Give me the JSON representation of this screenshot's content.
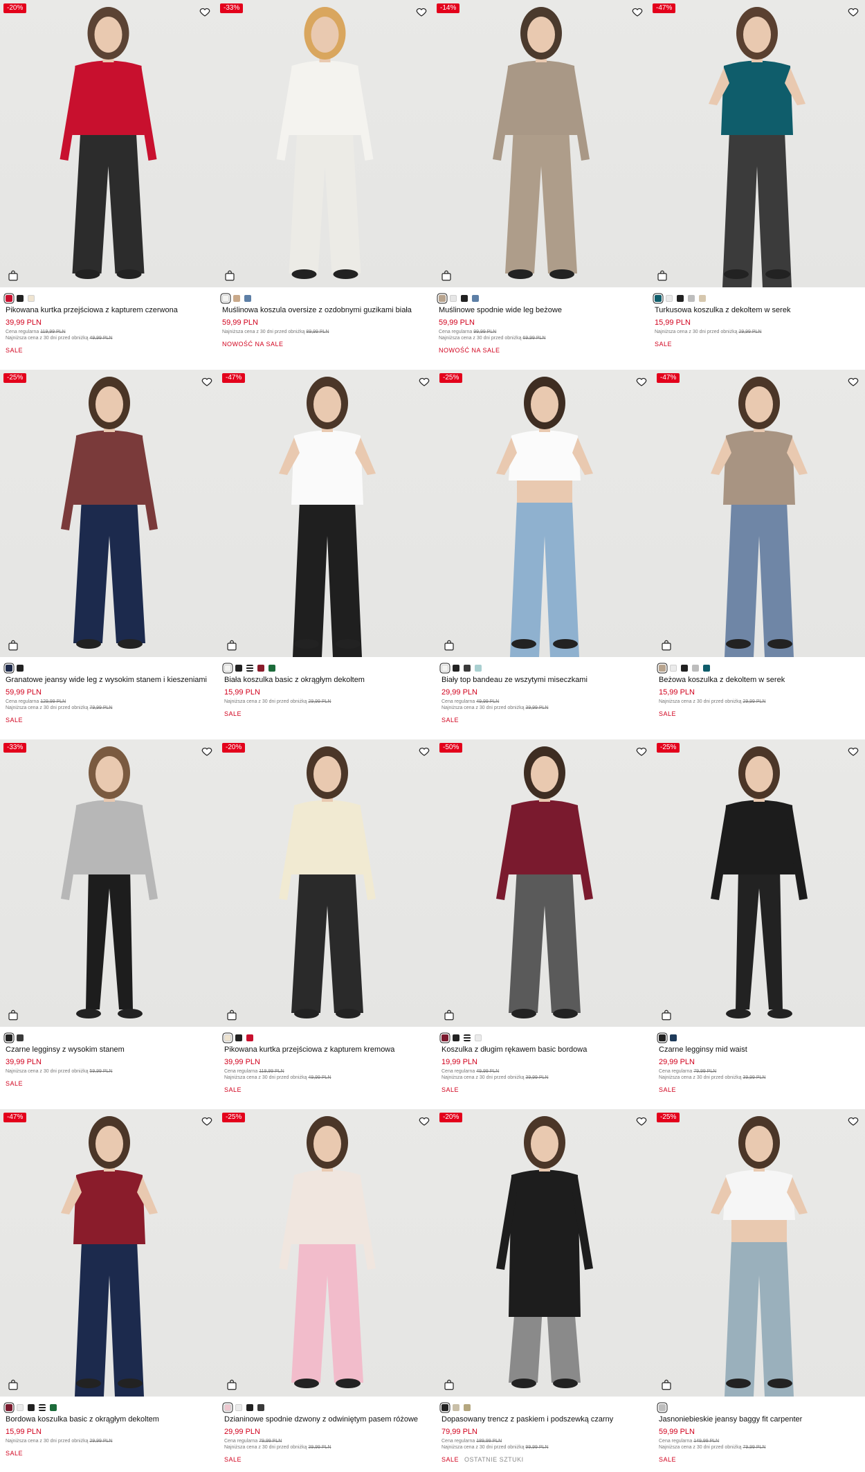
{
  "labels": {
    "regular": "Cena regularna",
    "lowest": "Najniższa cena z 30 dni przed obniżką"
  },
  "colors": {
    "accent": "#d1001c",
    "badge": "#e3001b",
    "photo_bg": "#e5e5e3"
  },
  "products": [
    {
      "badge": "-20%",
      "name": "Pikowana kurtka przejściowa z kapturem czerwona",
      "price": "39,99 PLN",
      "regular": "119,99 PLN",
      "lowest": "49,99 PLN",
      "tag": "SALE",
      "extra": "",
      "swatches": [
        "#c8102e",
        "#222222",
        "#efe4d0"
      ],
      "garment": {
        "top": "#c8102e",
        "bottom": "#2c2c2c",
        "hair": "#5b4334",
        "kind": "jacket-pants"
      }
    },
    {
      "badge": "-33%",
      "name": "Muślinowa koszula oversize z ozdobnymi guzikami biała",
      "price": "59,99 PLN",
      "regular": "",
      "lowest": "89,99 PLN",
      "tag": "NOWOŚĆ NA SALE",
      "extra": "",
      "swatches": [
        "#f4f4f2",
        "#c9a98a",
        "#5d7fa6"
      ],
      "garment": {
        "top": "#f4f3ef",
        "bottom": "#ecebe6",
        "hair": "#d9a65e",
        "kind": "shirt-pants"
      }
    },
    {
      "badge": "-14%",
      "name": "Muślinowe spodnie wide leg beżowe",
      "price": "59,99 PLN",
      "regular": "99,99 PLN",
      "lowest": "69,99 PLN",
      "tag": "NOWOŚĆ NA SALE",
      "extra": "",
      "swatches": [
        "#b8a48e",
        "#e6e6e6",
        "#222222",
        "#5d7fa6"
      ],
      "garment": {
        "top": "#a99886",
        "bottom": "#ae9d8a",
        "hair": "#4b3a2d",
        "kind": "shirt-pants"
      }
    },
    {
      "badge": "-47%",
      "name": "Turkusowa koszulka z dekoltem w serek",
      "price": "15,99 PLN",
      "regular": "",
      "lowest": "29,99 PLN",
      "tag": "SALE",
      "extra": "",
      "swatches": [
        "#0f5d6b",
        "#ebebeb",
        "#222222",
        "#bdbdbd",
        "#d6c7ae"
      ],
      "garment": {
        "top": "#0f5d6b",
        "bottom": "#3b3b3b",
        "hair": "#5a4030",
        "kind": "tee-jeans"
      }
    },
    {
      "badge": "-25%",
      "name": "Granatowe jeansy wide leg z wysokim stanem i kieszeniami",
      "price": "59,99 PLN",
      "regular": "129,99 PLN",
      "lowest": "79,99 PLN",
      "tag": "SALE",
      "extra": "",
      "swatches": [
        "#1e2a4a",
        "#222222"
      ],
      "garment": {
        "top": "#7a3a3a",
        "bottom": "#1c2a4d",
        "hair": "#4a3526",
        "kind": "shirt-pants"
      }
    },
    {
      "badge": "-47%",
      "name": "Biała koszulka basic z okrągłym dekoltem",
      "price": "15,99 PLN",
      "regular": "",
      "lowest": "29,99 PLN",
      "tag": "SALE",
      "extra": "",
      "swatches": [
        "#f4f4f2",
        "#222222",
        "stripes",
        "#8a1c2b",
        "#1c6b3a"
      ],
      "garment": {
        "top": "#fafafa",
        "bottom": "#1f1f1f",
        "hair": "#4b3628",
        "kind": "tee-jeans"
      }
    },
    {
      "badge": "-25%",
      "name": "Biały top bandeau ze wszytymi miseczkami",
      "price": "29,99 PLN",
      "regular": "49,99 PLN",
      "lowest": "39,99 PLN",
      "tag": "SALE",
      "extra": "",
      "swatches": [
        "#f4f4f2",
        "#222222",
        "#3a3a3a",
        "#a9cfd0"
      ],
      "garment": {
        "top": "#fbfbfb",
        "bottom": "#8fb1cf",
        "hair": "#3e2d22",
        "kind": "bandeau"
      }
    },
    {
      "badge": "-47%",
      "name": "Beżowa koszulka z dekoltem w serek",
      "price": "15,99 PLN",
      "regular": "",
      "lowest": "29,99 PLN",
      "tag": "SALE",
      "extra": "",
      "swatches": [
        "#b8a48e",
        "#ebebeb",
        "#222222",
        "#bdbdbd",
        "#0f5d6b"
      ],
      "garment": {
        "top": "#a89482",
        "bottom": "#6f86a6",
        "hair": "#4b3628",
        "kind": "tee-jeans"
      }
    },
    {
      "badge": "-33%",
      "name": "Czarne legginsy z wysokim stanem",
      "price": "39,99 PLN",
      "regular": "",
      "lowest": "59,99 PLN",
      "tag": "SALE",
      "extra": "",
      "swatches": [
        "#222222",
        "#3a3a3a"
      ],
      "garment": {
        "top": "#b7b7b7",
        "bottom": "#1d1d1d",
        "hair": "#7a5a40",
        "kind": "jacket-leggings"
      }
    },
    {
      "badge": "-20%",
      "name": "Pikowana kurtka przejściowa z kapturem kremowa",
      "price": "39,99 PLN",
      "regular": "119,99 PLN",
      "lowest": "49,99 PLN",
      "tag": "SALE",
      "extra": "",
      "swatches": [
        "#efe4d0",
        "#222222",
        "#c8102e"
      ],
      "garment": {
        "top": "#f1ead2",
        "bottom": "#2a2a2a",
        "hair": "#4b3628",
        "kind": "jacket-pants"
      }
    },
    {
      "badge": "-50%",
      "name": "Koszulka z długim rękawem basic bordowa",
      "price": "19,99 PLN",
      "regular": "49,99 PLN",
      "lowest": "39,99 PLN",
      "tag": "SALE",
      "extra": "",
      "swatches": [
        "#7a1a2e",
        "#222222",
        "stripes",
        "#ebebeb"
      ],
      "garment": {
        "top": "#7a1a2e",
        "bottom": "#5a5a5a",
        "hair": "#3e2d22",
        "kind": "longsleeve-plaid"
      }
    },
    {
      "badge": "-25%",
      "name": "Czarne legginsy mid waist",
      "price": "29,99 PLN",
      "regular": "79,99 PLN",
      "lowest": "39,99 PLN",
      "tag": "SALE",
      "extra": "",
      "swatches": [
        "#222222",
        "#1e3a5a"
      ],
      "garment": {
        "top": "#1c1c1c",
        "bottom": "#222222",
        "hair": "#4b3628",
        "kind": "hoodie-leggings"
      }
    },
    {
      "badge": "-47%",
      "name": "Bordowa koszulka basic z okrągłym dekoltem",
      "price": "15,99 PLN",
      "regular": "",
      "lowest": "29,99 PLN",
      "tag": "SALE",
      "extra": "",
      "swatches": [
        "#7a1a2e",
        "#ebebeb",
        "#222222",
        "stripes",
        "#1c6b3a"
      ],
      "garment": {
        "top": "#8a1c2b",
        "bottom": "#1c2a4d",
        "hair": "#4b3628",
        "kind": "tee-jeans"
      }
    },
    {
      "badge": "-25%",
      "name": "Dzianinowe spodnie dzwony z odwiniętym pasem różowe",
      "price": "29,99 PLN",
      "regular": "79,99 PLN",
      "lowest": "39,99 PLN",
      "tag": "SALE",
      "extra": "",
      "swatches": [
        "#efc7cf",
        "#ebebeb",
        "#222222",
        "#3a3a3a"
      ],
      "garment": {
        "top": "#f0e6df",
        "bottom": "#f2bccb",
        "hair": "#4b3628",
        "kind": "shirt-pants"
      }
    },
    {
      "badge": "-20%",
      "name": "Dopasowany trencz z paskiem i podszewką czarny",
      "price": "79,99 PLN",
      "regular": "189,99 PLN",
      "lowest": "99,99 PLN",
      "tag": "SALE",
      "extra": "OSTATNIE SZTUKI",
      "swatches": [
        "#222222",
        "#c9bfa8",
        "#b5a77f"
      ],
      "garment": {
        "top": "#1d1d1d",
        "bottom": "#8a8a8a",
        "hair": "#4b3628",
        "kind": "coat"
      }
    },
    {
      "badge": "-25%",
      "name": "Jasnoniebieskie jeansy baggy fit carpenter",
      "price": "59,99 PLN",
      "regular": "149,99 PLN",
      "lowest": "79,99 PLN",
      "tag": "SALE",
      "extra": "",
      "swatches": [
        "#bdbdbd"
      ],
      "garment": {
        "top": "#f6f6f6",
        "bottom": "#9ab0bc",
        "hair": "#4b3628",
        "kind": "crop-jeans"
      }
    }
  ]
}
